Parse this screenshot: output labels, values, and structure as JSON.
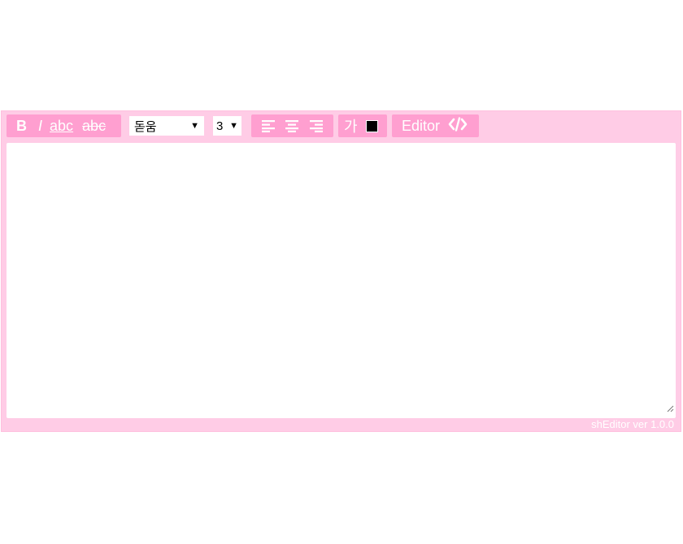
{
  "toolbar": {
    "bold_label": "B",
    "italic_label": "I",
    "underline_label": "abc",
    "strike_label": "abc",
    "font_select_value": "돋움",
    "size_select_value": "3",
    "color_label": "가",
    "color_value": "#000000",
    "mode_label": "Editor"
  },
  "footer": {
    "version": "shEditor ver 1.0.0"
  },
  "colors": {
    "frame": "#ffcce6",
    "button_bg": "#ff9fd0",
    "text_on_button": "#ffffff"
  },
  "icons": [
    "caret-down-icon",
    "align-left-icon",
    "align-center-icon",
    "align-right-icon",
    "code-icon",
    "resize-handle-icon"
  ]
}
